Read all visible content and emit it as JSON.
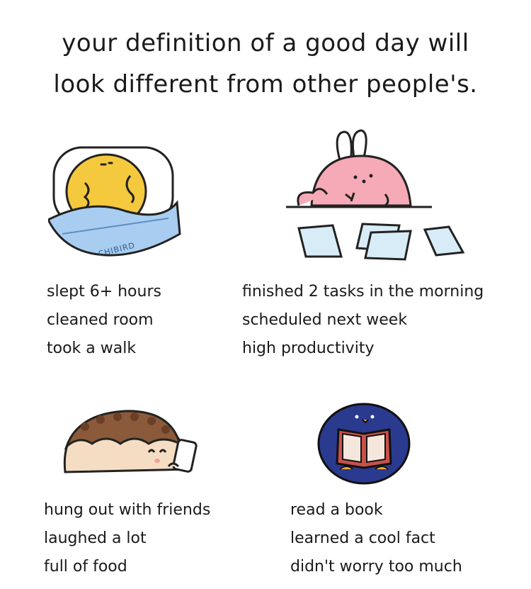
{
  "title": {
    "line1": "your definition of a good day will",
    "line2": "look different from other people's."
  },
  "watermark": "CHIBIRD",
  "panels": [
    {
      "name": "sleeping-chick",
      "items": [
        "slept 6+ hours",
        "cleaned room",
        "took a walk"
      ]
    },
    {
      "name": "working-bunny",
      "items": [
        "finished 2 tasks in the morning",
        "scheduled next week",
        "high productivity"
      ]
    },
    {
      "name": "hedgehog-phone",
      "items": [
        "hung out with friends",
        "laughed a lot",
        "full of food"
      ]
    },
    {
      "name": "penguin-reading",
      "items": [
        "read a book",
        "learned a cool fact",
        "didn't worry too much"
      ]
    }
  ],
  "colors": {
    "chick": "#f5c93e",
    "blanket": "#a9cdf0",
    "bunny": "#f6a9b6",
    "paper": "#d8ecf8",
    "hedgehog_body": "#f4ddc3",
    "hedgehog_spikes": "#8a5a3a",
    "penguin": "#2a3a8f",
    "book": "#c8514a"
  }
}
